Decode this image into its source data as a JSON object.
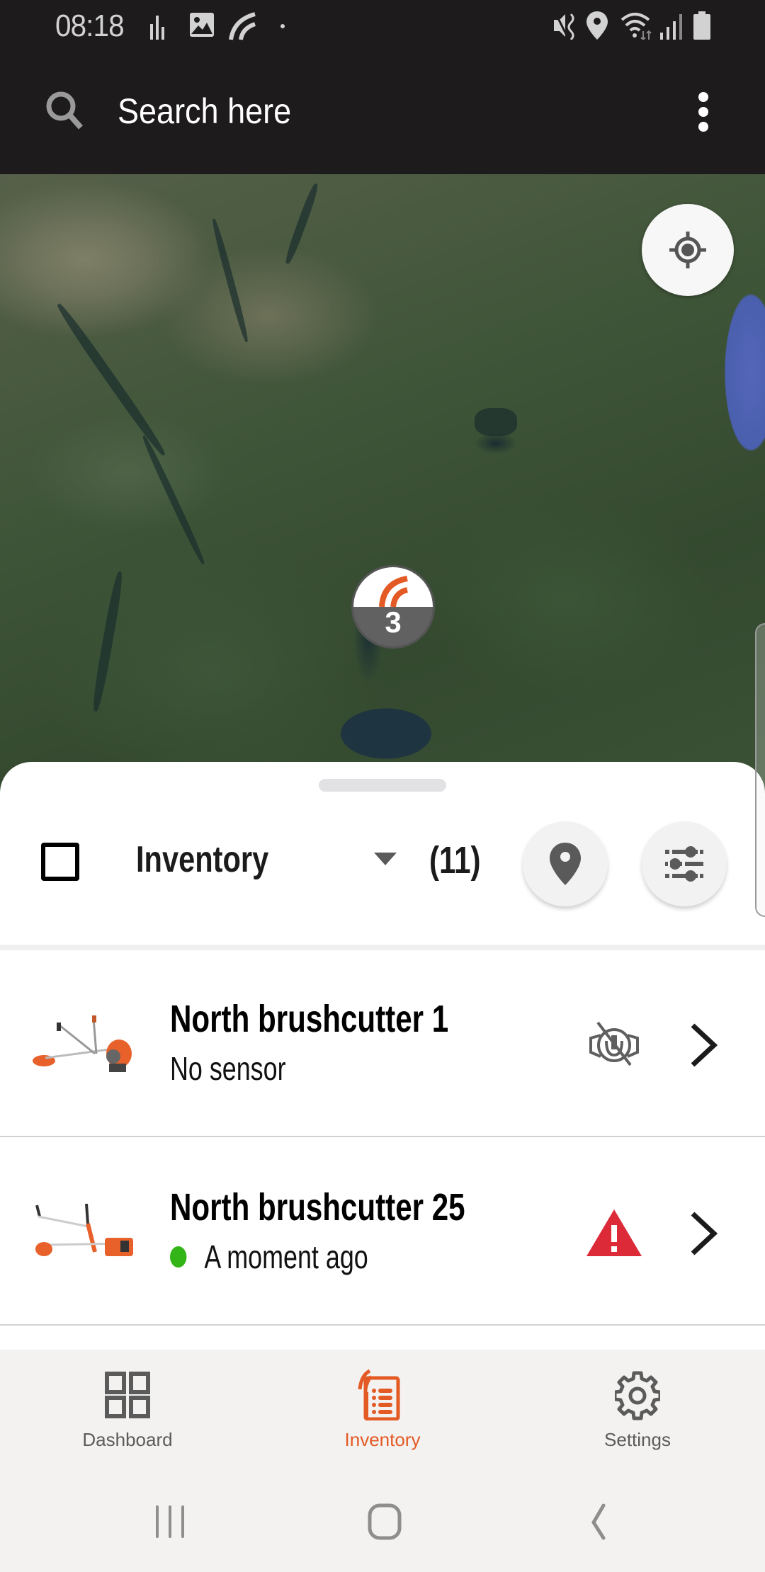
{
  "status_bar": {
    "time": "08:18",
    "left_icons": [
      "signal-bars-icon",
      "image-icon",
      "app-signal-icon",
      "dot-icon"
    ],
    "right_icons": [
      "mute-vibrate-icon",
      "location-icon",
      "wifi-icon",
      "cell-signal-icon",
      "battery-icon"
    ]
  },
  "search": {
    "placeholder": "Search here",
    "icon": "search-icon",
    "menu_icon": "more-vert-icon"
  },
  "map": {
    "locate_icon": "my-location-icon",
    "cluster": {
      "count": "3",
      "icon": "signal-arcs-icon"
    }
  },
  "sheet": {
    "dropdown_label": "Inventory",
    "count": "(11)",
    "map_pin_icon": "map-pin-icon",
    "filter_icon": "filter-sliders-icon"
  },
  "items": [
    {
      "name": "North brushcutter 1",
      "status": "No sensor",
      "status_dot": false,
      "state_icon": "no-sensor-icon",
      "image": "brushcutter-petrol-image"
    },
    {
      "name": "North brushcutter 25",
      "status": "A moment ago",
      "status_dot": true,
      "status_dot_color": "#33b518",
      "state_icon": "warning-icon",
      "image": "brushcutter-battery-image"
    }
  ],
  "bottom_nav": {
    "items": [
      {
        "label": "Dashboard",
        "icon": "dashboard-grid-icon",
        "active": false
      },
      {
        "label": "Inventory",
        "icon": "inventory-list-icon",
        "active": true
      },
      {
        "label": "Settings",
        "icon": "gear-icon",
        "active": false
      }
    ]
  },
  "colors": {
    "accent": "#e35a24",
    "warning": "#dc2a38",
    "online": "#33b518",
    "header_bg": "#1d1b1c"
  }
}
